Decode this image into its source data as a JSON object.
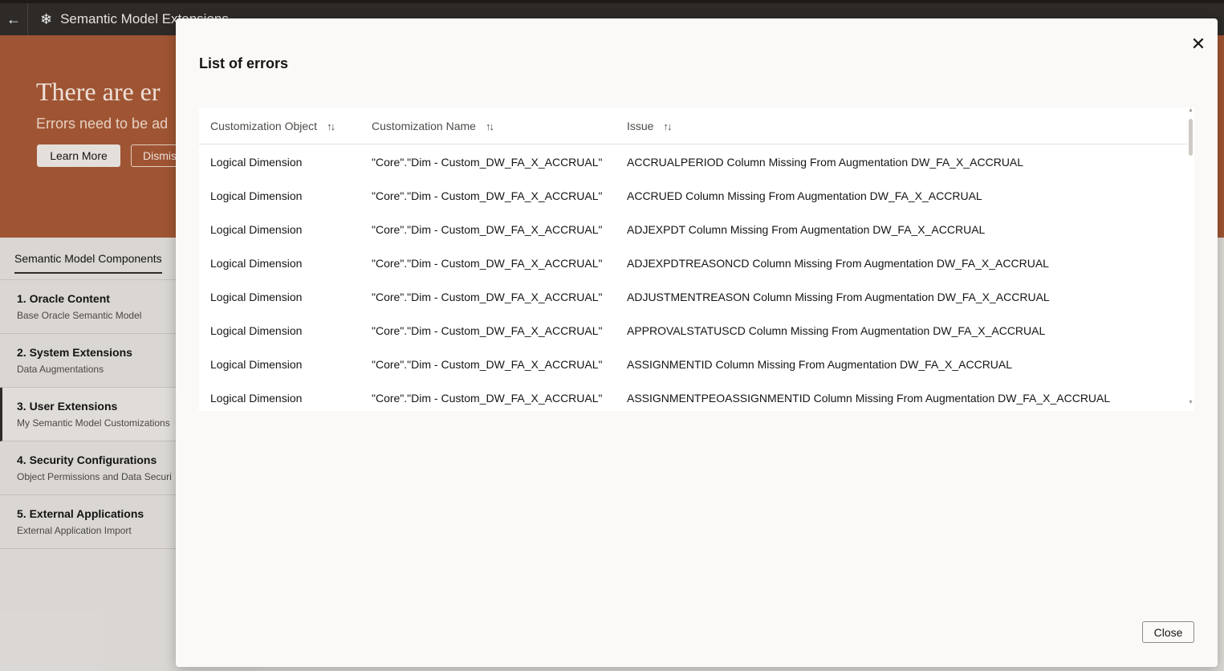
{
  "app": {
    "back_icon": "arrow-left-icon",
    "icon": "snowflake-icon",
    "title": "Semantic Model Extensions"
  },
  "banner": {
    "title": "There are er",
    "subtitle": "Errors need to be ad",
    "learn_more_label": "Learn More",
    "dismiss_label": "Dismis"
  },
  "sidebar": {
    "tab_label": "Semantic Model Components",
    "items": [
      {
        "title": "1. Oracle Content",
        "subtitle": "Base Oracle Semantic Model"
      },
      {
        "title": "2. System Extensions",
        "subtitle": "Data Augmentations"
      },
      {
        "title": "3. User Extensions",
        "subtitle": "My Semantic Model Customizations"
      },
      {
        "title": "4. Security Configurations",
        "subtitle": "Object Permissions and Data Securi"
      },
      {
        "title": "5. External Applications",
        "subtitle": "External Application Import"
      }
    ]
  },
  "dialog": {
    "title": "List of errors",
    "close_icon": "close-icon",
    "close_button_label": "Close",
    "columns": [
      "Customization Object",
      "Customization Name",
      "Issue"
    ],
    "sort_icon": "sort-icon",
    "rows": [
      [
        "Logical Dimension",
        "\"Core\".\"Dim - Custom_DW_FA_X_ACCRUAL\"",
        "ACCRUALPERIOD Column Missing From Augmentation DW_FA_X_ACCRUAL"
      ],
      [
        "Logical Dimension",
        "\"Core\".\"Dim - Custom_DW_FA_X_ACCRUAL\"",
        "ACCRUED Column Missing From Augmentation DW_FA_X_ACCRUAL"
      ],
      [
        "Logical Dimension",
        "\"Core\".\"Dim - Custom_DW_FA_X_ACCRUAL\"",
        "ADJEXPDT Column Missing From Augmentation DW_FA_X_ACCRUAL"
      ],
      [
        "Logical Dimension",
        "\"Core\".\"Dim - Custom_DW_FA_X_ACCRUAL\"",
        "ADJEXPDTREASONCD Column Missing From Augmentation DW_FA_X_ACCRUAL"
      ],
      [
        "Logical Dimension",
        "\"Core\".\"Dim - Custom_DW_FA_X_ACCRUAL\"",
        "ADJUSTMENTREASON Column Missing From Augmentation DW_FA_X_ACCRUAL"
      ],
      [
        "Logical Dimension",
        "\"Core\".\"Dim - Custom_DW_FA_X_ACCRUAL\"",
        "APPROVALSTATUSCD Column Missing From Augmentation DW_FA_X_ACCRUAL"
      ],
      [
        "Logical Dimension",
        "\"Core\".\"Dim - Custom_DW_FA_X_ACCRUAL\"",
        "ASSIGNMENTID Column Missing From Augmentation DW_FA_X_ACCRUAL"
      ],
      [
        "Logical Dimension",
        "\"Core\".\"Dim - Custom_DW_FA_X_ACCRUAL\"",
        "ASSIGNMENTPEOASSIGNMENTID Column Missing From Augmentation DW_FA_X_ACCRUAL"
      ]
    ]
  }
}
